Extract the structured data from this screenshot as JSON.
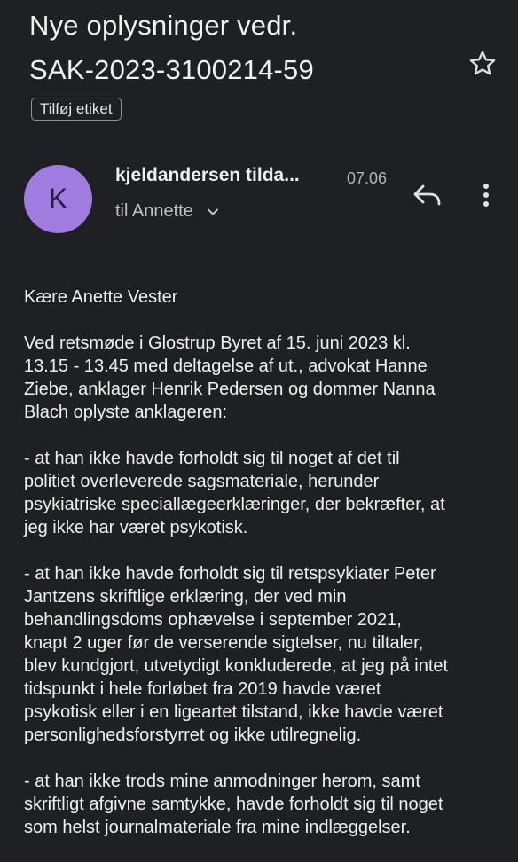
{
  "email": {
    "subject_lines": [
      "Nye oplysninger vedr.",
      "SAK-2023-3100214-59"
    ],
    "add_label": "Tilføj etiket",
    "avatar_letter": "K",
    "sender": "kjeldandersen tilda...",
    "time": "07.06",
    "recipients": "til Annette",
    "icons": {
      "star": "star-outline-icon",
      "reply": "reply-icon",
      "more": "more-vert-icon",
      "expand": "chevron-down-icon"
    },
    "body": {
      "greeting": "Kære Anette Vester",
      "paragraphs": [
        [
          "Ved retsmøde i Glostrup Byret af 15. juni 2023 kl.",
          "13.15 - 13.45 med deltagelse af ut., advokat Hanne",
          "Ziebe, anklager Henrik Pedersen og dommer Nanna",
          "Blach oplyste anklageren:"
        ],
        [
          "- at han ikke havde forholdt sig til noget af det til",
          "politiet overleverede sagsmateriale, herunder",
          "psykiatriske speciallægeerklæringer, der bekræfter, at",
          "jeg ikke har været psykotisk."
        ],
        [
          "- at han ikke havde forholdt sig til retspsykiater Peter",
          "Jantzens skriftlige erklæring, der ved min",
          "behandlingsdoms ophævelse i september 2021,",
          "knapt 2 uger før de verserende sigtelser, nu tiltaler,",
          "blev kundgjort, utvetydigt konkluderede, at jeg på intet",
          "tidspunkt i hele forløbet fra 2019 havde været",
          "psykotisk eller i en ligeartet tilstand, ikke havde været",
          "personlighedsforstyrret og ikke utilregnelig."
        ],
        [
          "- at han ikke trods mine anmodninger herom, samt",
          "skriftligt afgivne samtykke, havde forholdt sig til noget",
          "som helst journalmateriale fra mine indlæggelser."
        ]
      ]
    }
  },
  "colors": {
    "background": "#1f2023",
    "avatar": "#a07ce0",
    "text": "#ececec"
  }
}
